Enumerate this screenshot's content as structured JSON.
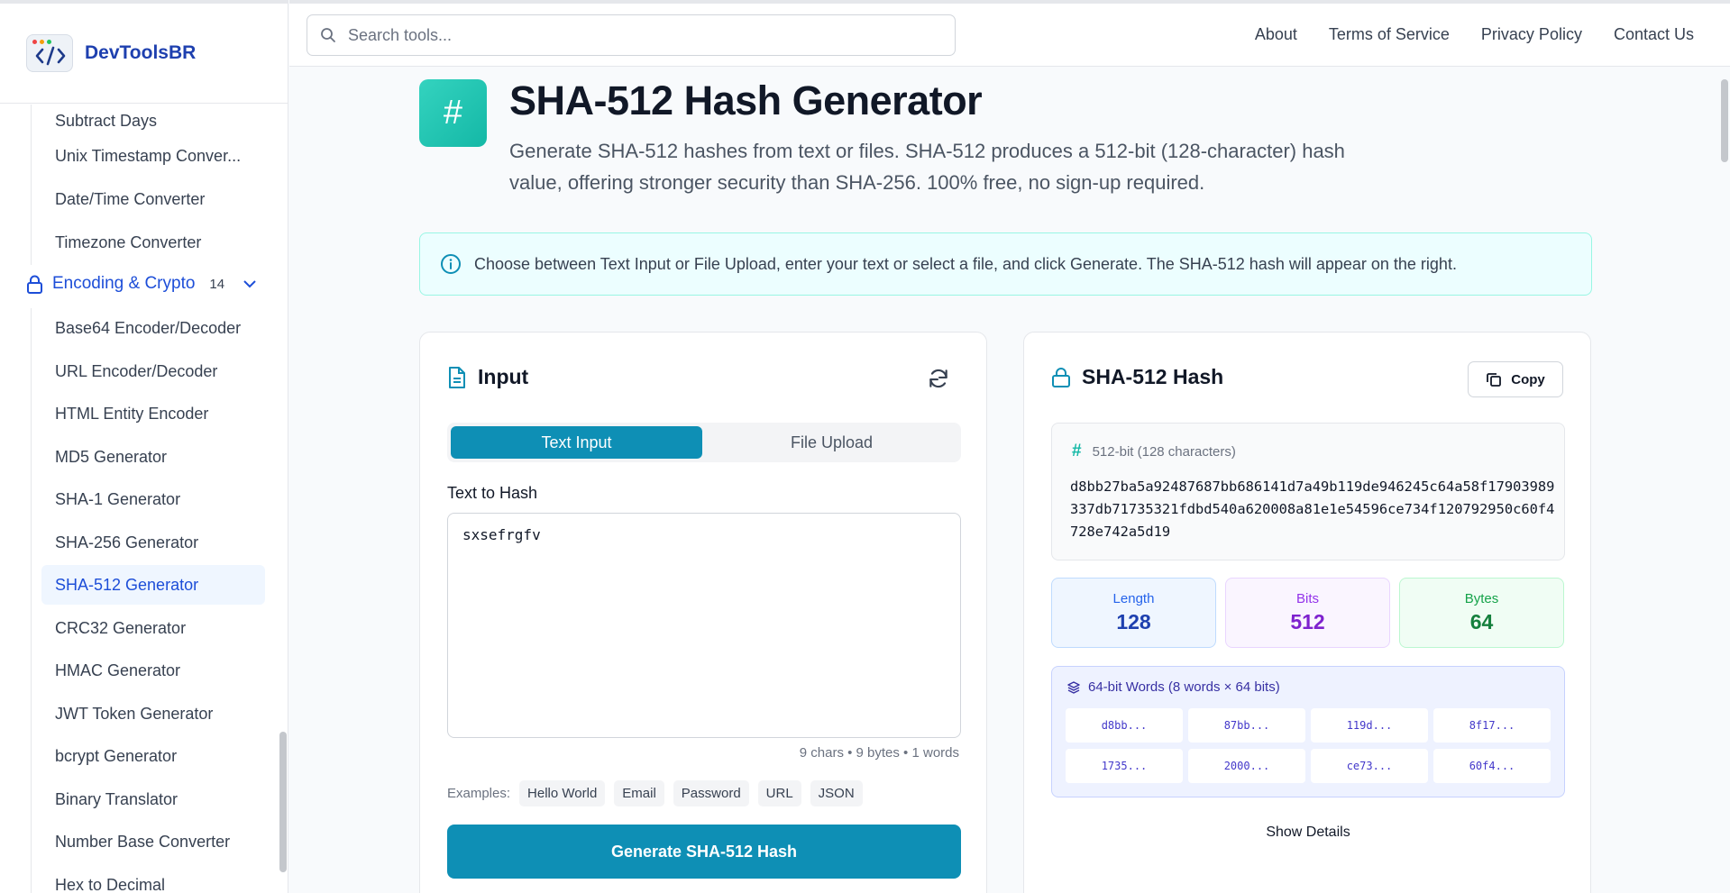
{
  "brand": {
    "name": "DevToolsBR"
  },
  "search": {
    "placeholder": "Search tools..."
  },
  "top_nav": [
    "About",
    "Terms of Service",
    "Privacy Policy",
    "Contact Us"
  ],
  "sidebar": {
    "items_before": [
      "Subtract Days",
      "Unix Timestamp Conver...",
      "Date/Time Converter",
      "Timezone Converter"
    ],
    "category": {
      "label": "Encoding & Crypto",
      "count": "14"
    },
    "items": [
      "Base64 Encoder/Decoder",
      "URL Encoder/Decoder",
      "HTML Entity Encoder",
      "MD5 Generator",
      "SHA-1 Generator",
      "SHA-256 Generator",
      "SHA-512 Generator",
      "CRC32 Generator",
      "HMAC Generator",
      "JWT Token Generator",
      "bcrypt Generator",
      "Binary Translator",
      "Number Base Converter",
      "Hex to Decimal"
    ],
    "active_item": "SHA-512 Generator"
  },
  "hero": {
    "icon_glyph": "#",
    "title": "SHA-512 Hash Generator",
    "description": "Generate SHA-512 hashes from text or files. SHA-512 produces a 512-bit (128-character) hash value, offering stronger security than SHA-256. 100% free, no sign-up required."
  },
  "info": {
    "text": "Choose between Text Input or File Upload, enter your text or select a file, and click Generate. The SHA-512 hash will appear on the right."
  },
  "input_card": {
    "title": "Input",
    "tabs": [
      "Text Input",
      "File Upload"
    ],
    "field_label": "Text to Hash",
    "text_value": "sxsefrgfv",
    "stats": "9 chars • 9 bytes • 1 words",
    "examples_label": "Examples:",
    "examples": [
      "Hello World",
      "Email",
      "Password",
      "URL",
      "JSON"
    ],
    "generate_label": "Generate SHA-512 Hash"
  },
  "output_card": {
    "title": "SHA-512 Hash",
    "copy_label": "Copy",
    "hash_meta": "512-bit (128 characters)",
    "hash_value": "d8bb27ba5a92487687bb686141d7a49b119de946245c64a58f17903989337db71735321fdbd540a620008a81e1e54596ce734f120792950c60f4728e742a5d19",
    "stats": [
      {
        "label": "Length",
        "value": "128"
      },
      {
        "label": "Bits",
        "value": "512"
      },
      {
        "label": "Bytes",
        "value": "64"
      }
    ],
    "words_title": "64-bit Words (8 words × 64 bits)",
    "words": [
      "d8bb...",
      "87bb...",
      "119d...",
      "8f17...",
      "1735...",
      "2000...",
      "ce73...",
      "60f4..."
    ],
    "show_details_label": "Show Details"
  },
  "colors": {
    "accent": "#0e8fb5",
    "brand": "#1e40af",
    "teal": "#14b8a6"
  }
}
